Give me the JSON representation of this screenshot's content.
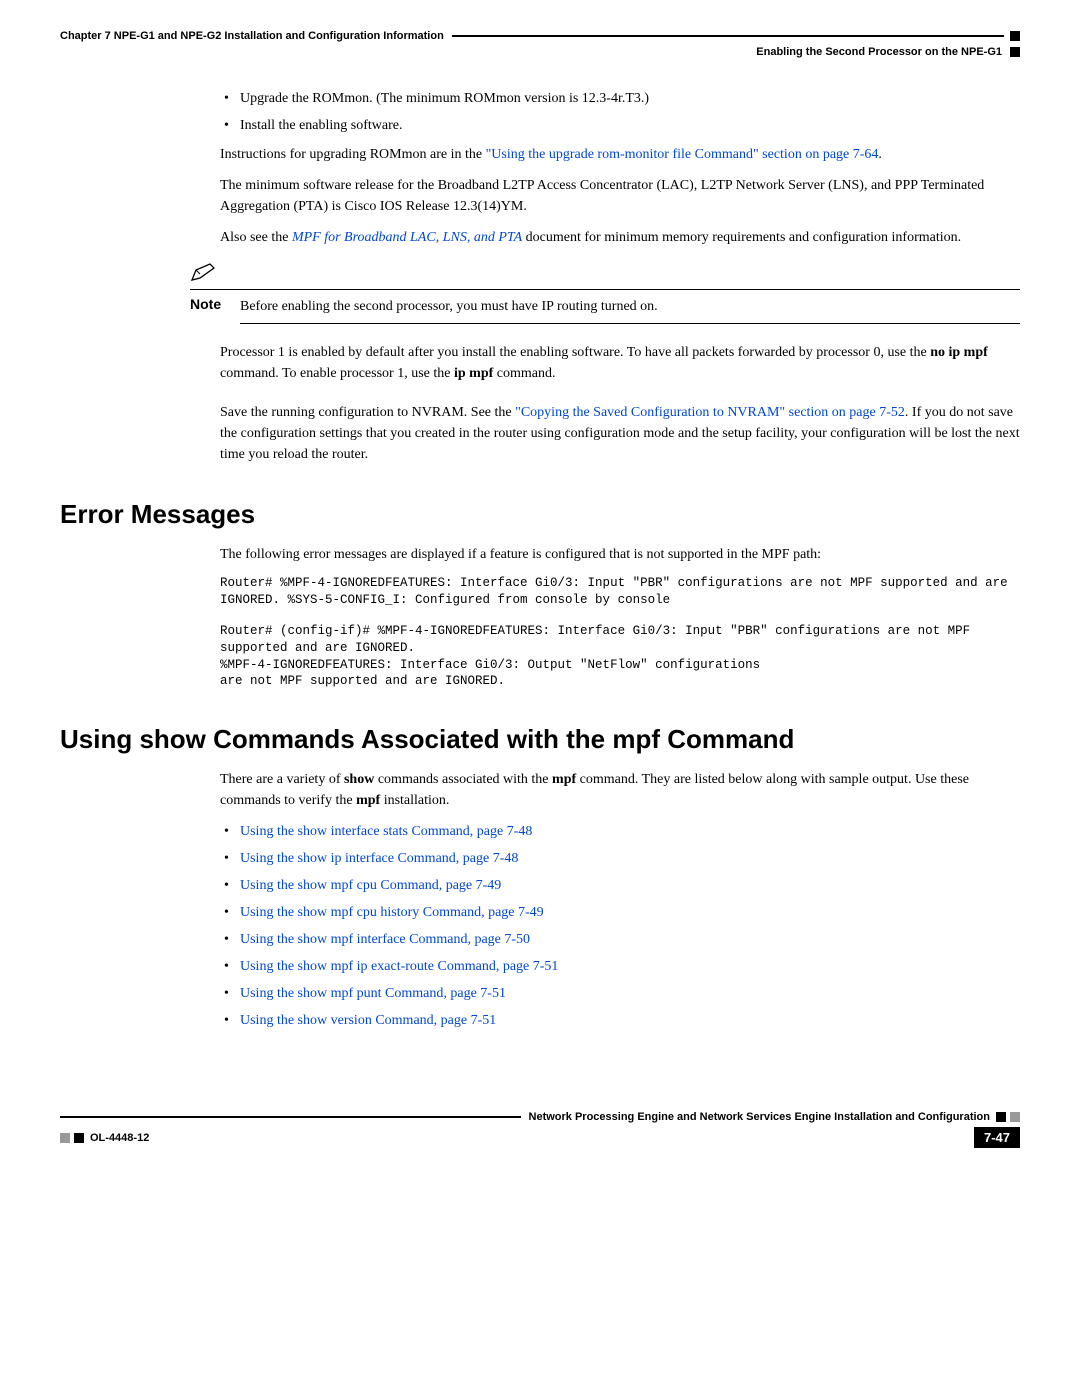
{
  "header": {
    "chapter": "Chapter 7      NPE-G1 and NPE-G2 Installation and Configuration Information",
    "section": "Enabling the Second Processor on the NPE-G1"
  },
  "intro": {
    "bullets": [
      "Upgrade the ROMmon. (The minimum ROMmon version is 12.3-4r.T3.)",
      "Install the enabling software."
    ],
    "p1_a": "Instructions for upgrading ROMmon are in the ",
    "p1_link": "\"Using the upgrade rom-monitor file Command\" section on page 7-64",
    "p1_b": ".",
    "p2": "The minimum software release for the Broadband L2TP Access Concentrator (LAC), L2TP Network Server (LNS), and PPP Terminated Aggregation (PTA) is Cisco IOS Release 12.3(14)YM.",
    "p3_a": "Also see the ",
    "p3_link": "MPF for Broadband LAC, LNS, and PTA",
    "p3_b": " document for minimum memory requirements and configuration information."
  },
  "note": {
    "label": "Note",
    "text": "Before enabling the second processor, you must have IP routing turned on."
  },
  "after_note": {
    "p1_a": "Processor 1 is enabled by default after you install the enabling software. To have all packets forwarded by processor 0, use the ",
    "p1_b1": "no ip mpf",
    "p1_c": " command. To enable processor 1, use the ",
    "p1_b2": "ip mpf",
    "p1_d": " command.",
    "p2_a": "Save the running configuration to NVRAM. See the ",
    "p2_link": "\"Copying the Saved Configuration to NVRAM\" section on page 7-52",
    "p2_b": ". If you do not save the configuration settings that you created in the router using configuration mode and the setup facility, your configuration will be lost the next time you reload the router."
  },
  "error": {
    "heading": "Error Messages",
    "intro": "The following error messages are displayed if a feature is configured that is not supported in the MPF path:",
    "code1": "Router# %MPF-4-IGNOREDFEATURES: Interface Gi0/3: Input \"PBR\" configurations are not MPF supported and are IGNORED. %SYS-5-CONFIG_I: Configured from console by console",
    "code2": "Router# (config-if)# %MPF-4-IGNOREDFEATURES: Interface Gi0/3: Input \"PBR\" configurations are not MPF supported and are IGNORED.\n%MPF-4-IGNOREDFEATURES: Interface Gi0/3: Output \"NetFlow\" configurations\nare not MPF supported and are IGNORED."
  },
  "show": {
    "heading": "Using show Commands Associated with the mpf Command",
    "intro_a": "There are a variety of ",
    "intro_b1": "show",
    "intro_b": " commands associated with the ",
    "intro_b2": "mpf",
    "intro_c": " command. They are listed below along with sample output. Use these commands to verify the ",
    "intro_b3": "mpf",
    "intro_d": " installation.",
    "links": [
      "Using the show interface stats Command, page 7-48",
      "Using the show ip interface Command, page 7-48",
      "Using the show mpf cpu Command, page 7-49",
      "Using the show mpf cpu history Command, page 7-49",
      "Using the show mpf interface Command, page 7-50",
      "Using the show mpf ip exact-route Command, page 7-51",
      "Using the show mpf punt Command, page 7-51",
      "Using the show version Command, page 7-51"
    ]
  },
  "footer": {
    "title": "Network Processing Engine and Network Services Engine Installation and Configuration",
    "docid": "OL-4448-12",
    "pagenum": "7-47"
  }
}
